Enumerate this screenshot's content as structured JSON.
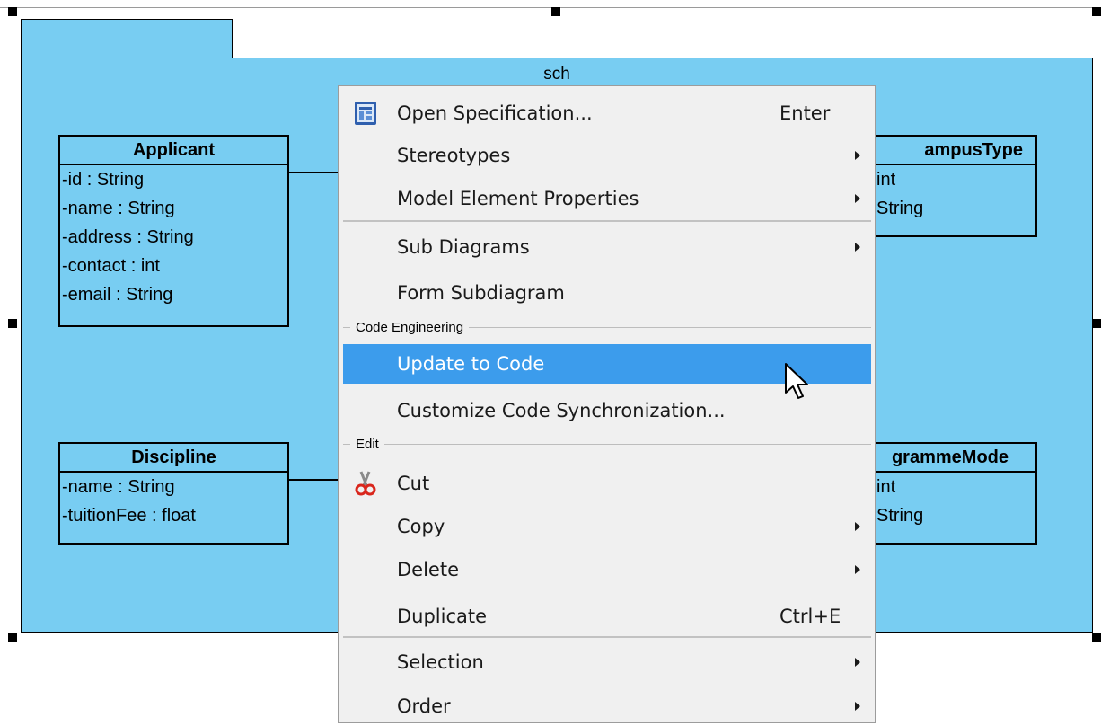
{
  "package": {
    "name": "sch"
  },
  "classes": [
    {
      "id": "applicant",
      "name": "Applicant",
      "attributes": [
        "-id : String",
        "-name : String",
        "-address : String",
        "-contact : int",
        "-email : String"
      ]
    },
    {
      "id": "campus-type",
      "name": "ampusType",
      "attributes": [
        " int",
        " String"
      ]
    },
    {
      "id": "discipline",
      "name": "Discipline",
      "attributes": [
        "-name : String",
        "-tuitionFee : float"
      ]
    },
    {
      "id": "programme-mode",
      "name": "grammeMode",
      "attributes": [
        " int",
        "String"
      ]
    }
  ],
  "context_menu": {
    "open_spec": {
      "label": "Open Specification...",
      "shortcut": "Enter",
      "icon": "specification-icon"
    },
    "stereotypes": {
      "label": "Stereotypes"
    },
    "model_props": {
      "label": "Model Element Properties"
    },
    "sub_diagrams": {
      "label": "Sub Diagrams"
    },
    "form_subdiagram": {
      "label": "Form Subdiagram"
    },
    "group_code": "Code Engineering",
    "update_code": {
      "label": "Update to Code"
    },
    "customize_sync": {
      "label": "Customize Code Synchronization..."
    },
    "group_edit": "Edit",
    "cut": {
      "label": "Cut",
      "icon": "scissors-icon"
    },
    "copy": {
      "label": "Copy"
    },
    "delete": {
      "label": "Delete"
    },
    "duplicate": {
      "label": "Duplicate",
      "shortcut": "Ctrl+E"
    },
    "selection": {
      "label": "Selection"
    },
    "order": {
      "label": "Order"
    }
  },
  "colors": {
    "package_fill": "#78cdf2",
    "menu_bg": "#f0f0f0",
    "highlight": "#3c9cec"
  }
}
